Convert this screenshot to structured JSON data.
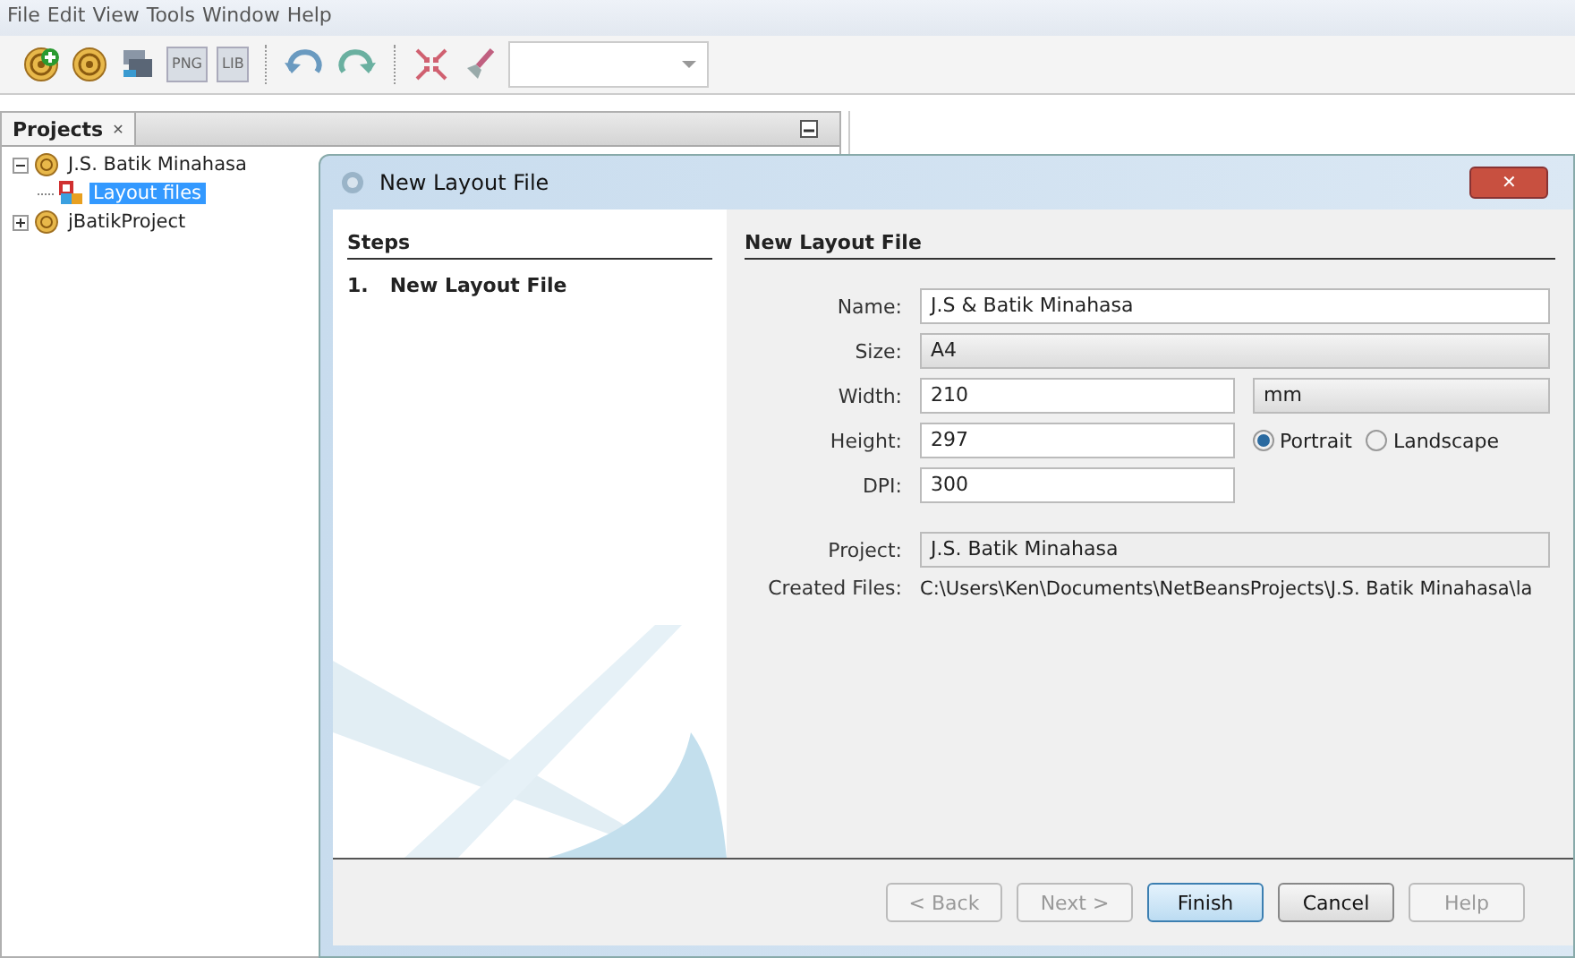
{
  "menu": [
    "File",
    "Edit",
    "View",
    "Tools",
    "Window",
    "Help"
  ],
  "toolbar": {
    "items": [
      {
        "kind": "new-project"
      },
      {
        "kind": "project"
      },
      {
        "kind": "print"
      },
      {
        "kind": "png"
      },
      {
        "kind": "lib"
      },
      {
        "kind": "sep"
      },
      {
        "kind": "undo"
      },
      {
        "kind": "redo"
      },
      {
        "kind": "sep"
      },
      {
        "kind": "shrink"
      },
      {
        "kind": "brush"
      }
    ],
    "png": "PNG",
    "lib": "LIB"
  },
  "projects_panel": {
    "title": "Projects",
    "close": "✕",
    "tree": [
      {
        "label": "J.S. Batik Minahasa",
        "expanded": true,
        "selected": false,
        "kind": "project",
        "children": [
          {
            "label": "Layout files",
            "selected": true,
            "kind": "layout"
          }
        ]
      },
      {
        "label": "jBatikProject",
        "expanded": false,
        "selected": false,
        "kind": "project"
      }
    ]
  },
  "dialog": {
    "title": "New Layout File",
    "close": "✕",
    "steps": {
      "title": "Steps",
      "items": [
        {
          "number": "1.",
          "label": "New Layout File"
        }
      ]
    },
    "panel_title": "New Layout File",
    "fields": [
      {
        "kind": "text",
        "label": "Name:",
        "value": "J.S & Batik Minahasa"
      },
      {
        "kind": "combo",
        "label": "Size:",
        "value": "A4"
      },
      {
        "kind": "text-combo",
        "label": "Width:",
        "value": "210",
        "unit": "mm"
      },
      {
        "kind": "text-radio",
        "label": "Height:",
        "value": "297",
        "options": [
          {
            "label": "Portrait",
            "selected": true
          },
          {
            "label": "Landscape",
            "selected": false
          }
        ]
      },
      {
        "kind": "text",
        "label": "DPI:",
        "value": "300"
      },
      {
        "kind": "readonly",
        "label": "Project:",
        "value": "J.S. Batik Minahasa"
      },
      {
        "kind": "plain",
        "label": "Created Files:",
        "value": "C:\\Users\\Ken\\Documents\\NetBeansProjects\\J.S. Batik Minahasa\\la"
      }
    ],
    "buttons": [
      {
        "label": "< Back",
        "disabled": true,
        "default": false
      },
      {
        "label": "Next >",
        "disabled": true,
        "default": false
      },
      {
        "label": "Finish",
        "disabled": false,
        "default": true
      },
      {
        "label": "Cancel",
        "disabled": false,
        "default": false
      },
      {
        "label": "Help",
        "disabled": true,
        "default": false
      }
    ]
  }
}
